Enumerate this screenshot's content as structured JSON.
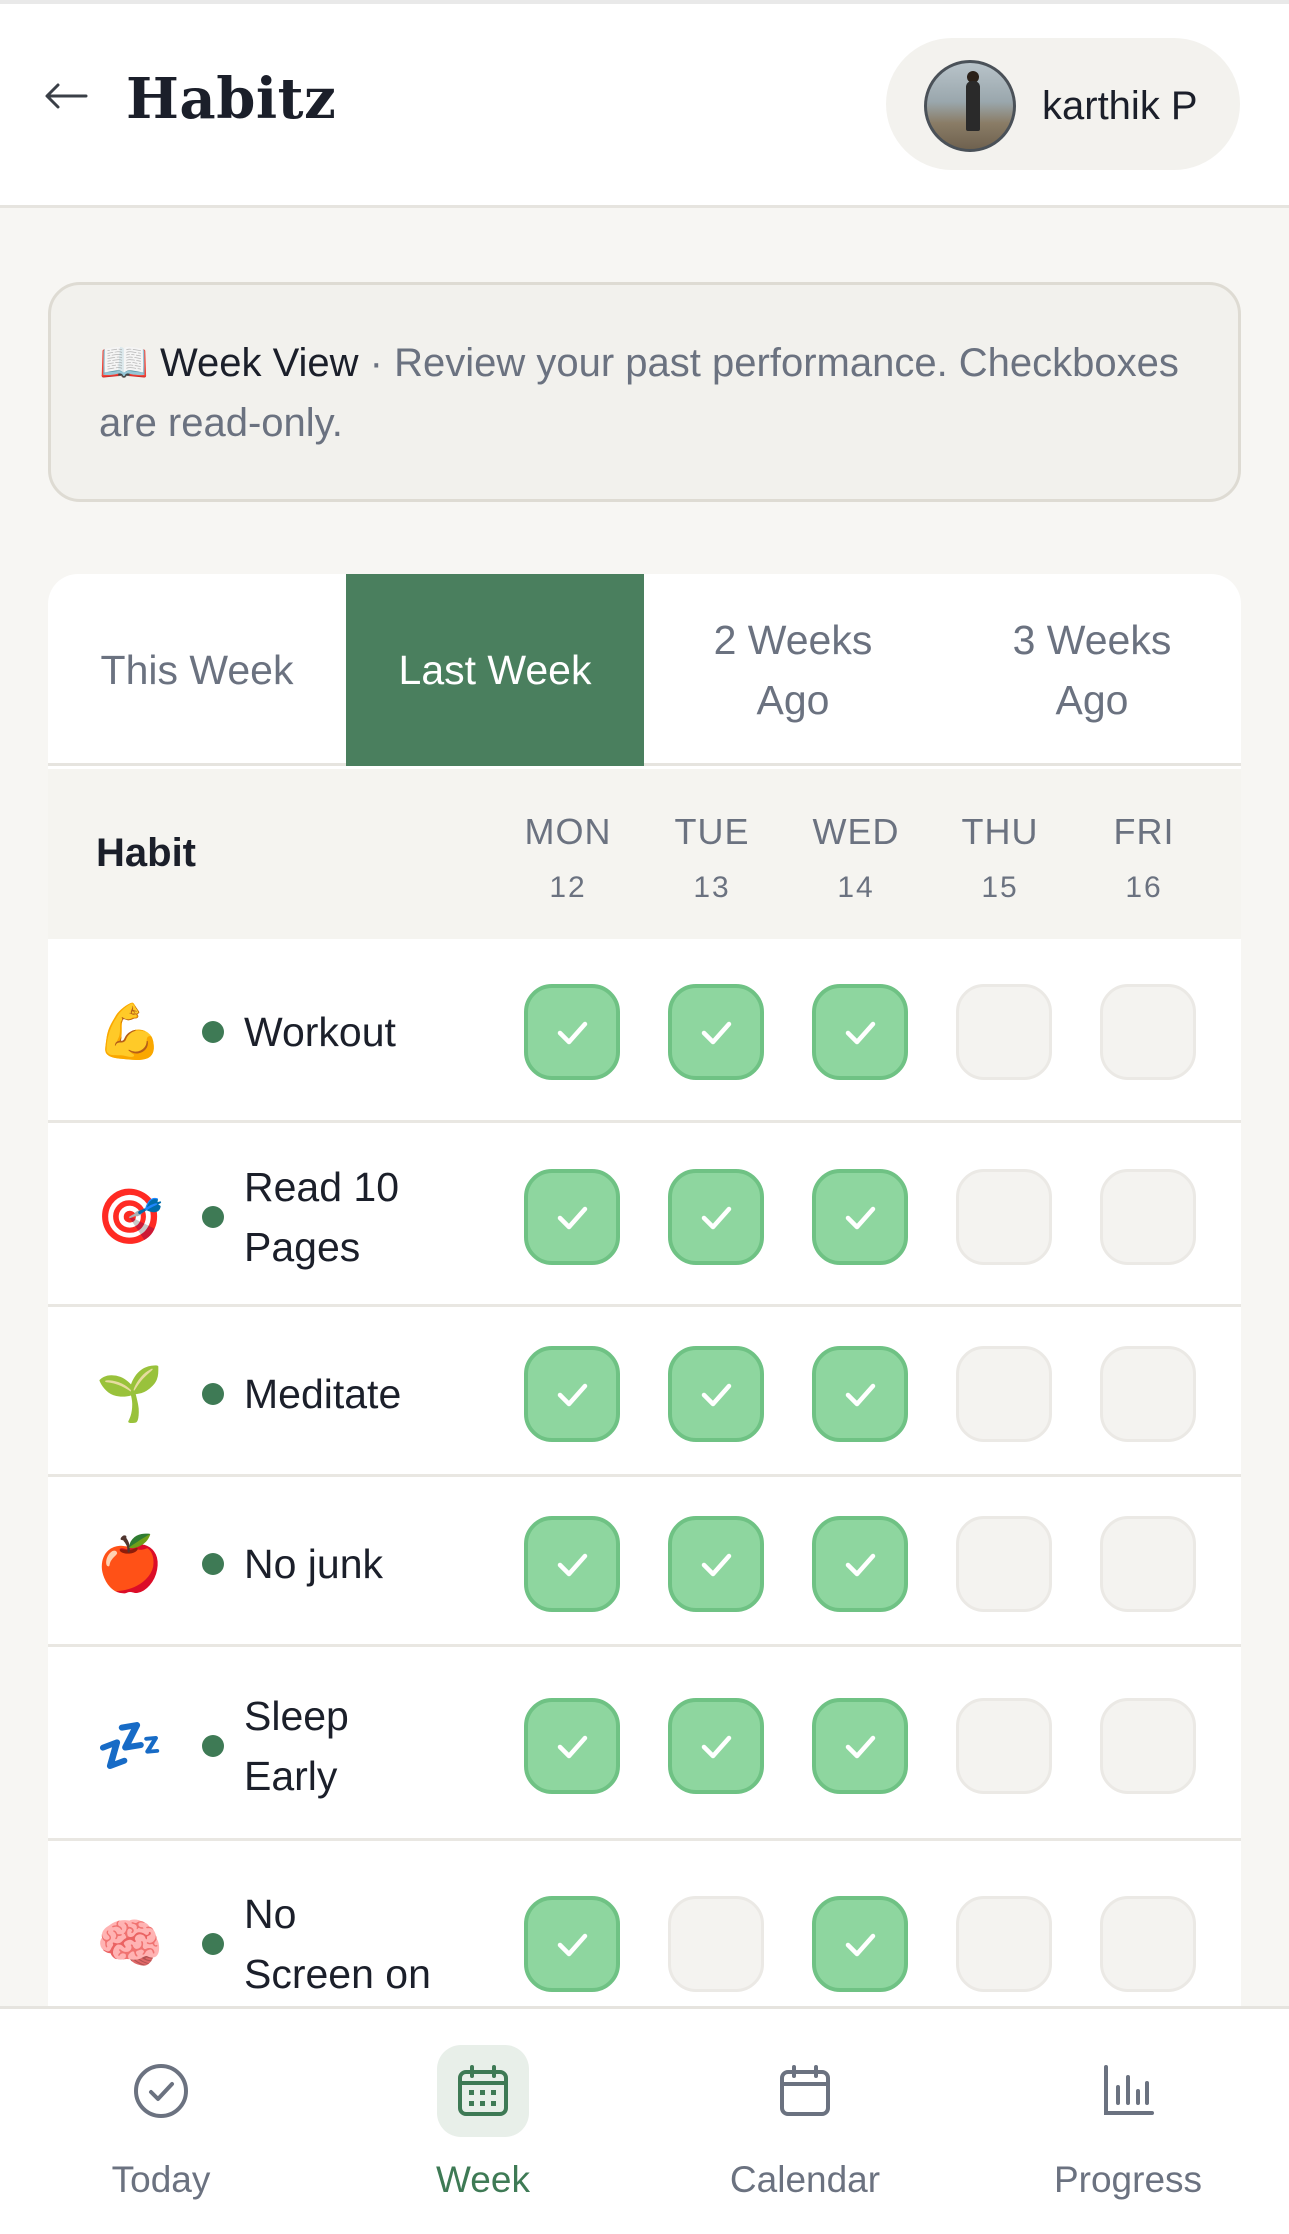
{
  "header": {
    "title": "Habitz",
    "user_name": "karthik P"
  },
  "banner": {
    "icon": "📖",
    "title": "Week View",
    "text": " · Review your past performance. Checkboxes are read-only."
  },
  "tabs": [
    {
      "label": "This Week",
      "active": false
    },
    {
      "label": "Last Week",
      "active": true
    },
    {
      "label": "2 Weeks Ago",
      "active": false
    },
    {
      "label": "3 Weeks Ago",
      "active": false
    }
  ],
  "table": {
    "habit_header": "Habit",
    "days": [
      {
        "name": "MON",
        "date": "12"
      },
      {
        "name": "TUE",
        "date": "13"
      },
      {
        "name": "WED",
        "date": "14"
      },
      {
        "name": "THU",
        "date": "15"
      },
      {
        "name": "FRI",
        "date": "16"
      }
    ],
    "rows": [
      {
        "emoji": "💪",
        "name": "Workout",
        "checks": [
          true,
          true,
          true,
          false,
          false
        ]
      },
      {
        "emoji": "🎯",
        "name": "Read 10 Pages",
        "checks": [
          true,
          true,
          true,
          false,
          false
        ]
      },
      {
        "emoji": "🌱",
        "name": "Meditate",
        "checks": [
          true,
          true,
          true,
          false,
          false
        ]
      },
      {
        "emoji": "🍎",
        "name": "No junk",
        "checks": [
          true,
          true,
          true,
          false,
          false
        ]
      },
      {
        "emoji": "💤",
        "name": "Sleep Early",
        "checks": [
          true,
          true,
          true,
          false,
          false
        ]
      },
      {
        "emoji": "🧠",
        "name": "No Screen on Bed",
        "checks": [
          true,
          false,
          true,
          false,
          false
        ]
      }
    ]
  },
  "bottom_nav": [
    {
      "label": "Today",
      "icon": "check-circle-icon",
      "active": false
    },
    {
      "label": "Week",
      "icon": "calendar-grid-icon",
      "active": true
    },
    {
      "label": "Calendar",
      "icon": "calendar-icon",
      "active": false
    },
    {
      "label": "Progress",
      "icon": "bar-chart-icon",
      "active": false
    }
  ],
  "colors": {
    "accent": "#4a7f5e",
    "check_on": "#8ed69f",
    "habit_dot": "#3e7a55"
  }
}
